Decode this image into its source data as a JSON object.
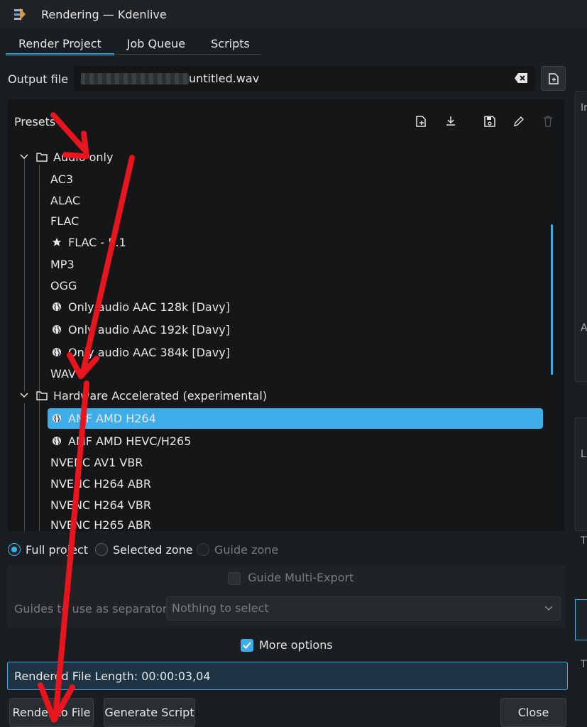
{
  "window": {
    "title": "Rendering — Kdenlive",
    "app_icon": "kdenlive-icon"
  },
  "tabs": [
    {
      "label": "Render Project",
      "active": true
    },
    {
      "label": "Job Queue",
      "active": false
    },
    {
      "label": "Scripts",
      "active": false
    }
  ],
  "output": {
    "label": "Output file",
    "value": "untitled.wav"
  },
  "presets": {
    "title": "Presets",
    "toolbar_icons": [
      "new-preset-icon",
      "download-icon",
      "save-icon",
      "edit-icon",
      "delete-icon"
    ],
    "groups": [
      {
        "label": "Audio only",
        "items": [
          {
            "label": "AC3",
            "icon": ""
          },
          {
            "label": "ALAC",
            "icon": ""
          },
          {
            "label": "FLAC",
            "icon": ""
          },
          {
            "label": "FLAC - 5.1",
            "icon": "star-icon"
          },
          {
            "label": "MP3",
            "icon": ""
          },
          {
            "label": "OGG",
            "icon": ""
          },
          {
            "label": "Only audio AAC 128k [Davy]",
            "icon": "globe-icon"
          },
          {
            "label": "Only audio AAC 192k [Davy]",
            "icon": "globe-icon"
          },
          {
            "label": "Only audio AAC 384k [Davy]",
            "icon": "globe-icon"
          },
          {
            "label": "WAV",
            "icon": "",
            "selected": true
          }
        ]
      },
      {
        "label": "Hardware Accelerated (experimental)",
        "items": [
          {
            "label": "AMF AMD H264",
            "icon": "globe-icon"
          },
          {
            "label": "AMF AMD HEVC/H265",
            "icon": "globe-icon"
          },
          {
            "label": "NVENC AV1 VBR",
            "icon": ""
          },
          {
            "label": "NVENC H264 ABR",
            "icon": ""
          },
          {
            "label": "NVENC H264 VBR",
            "icon": ""
          },
          {
            "label": "NVENC H265 ABR",
            "icon": ""
          }
        ]
      }
    ]
  },
  "zone": {
    "full_project": "Full project",
    "selected_zone": "Selected zone",
    "guide_zone": "Guide zone",
    "selected": "full_project"
  },
  "guides": {
    "multi_export": "Guide Multi-Export",
    "separator_label": "Guides to use as separator:",
    "separator_placeholder": "Nothing to select"
  },
  "more_options": {
    "label": "More options",
    "checked": true
  },
  "rendered_length": "Rendered File Length: 00:00:03,04",
  "buttons": {
    "render": "Render to File",
    "script": "Generate Script",
    "close": "Close"
  },
  "side_panel_fragments": {
    "a": "Ir",
    "b": "A",
    "c": "L",
    "d": "T",
    "e": "T"
  },
  "colors": {
    "accent": "#3daee9",
    "background": "#1b1e20",
    "annotation": "#e8141e"
  }
}
